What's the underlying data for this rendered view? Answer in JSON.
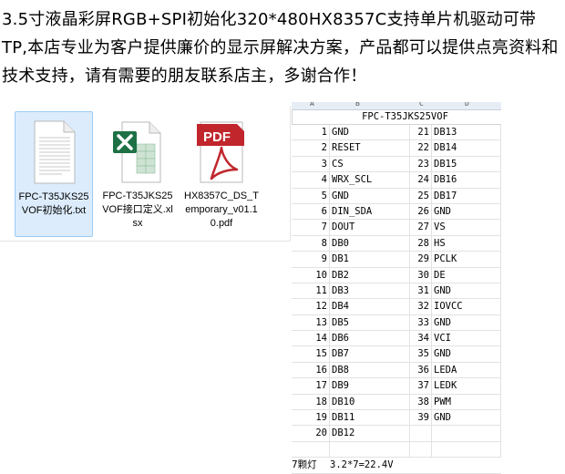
{
  "headline": "3.5寸液晶彩屏RGB+SPI初始化320*480HX8357C支持单片机驱动可带TP,本店专业为客户提供廉价的显示屏解决方案，产品都可以提供点亮资料和技术支持，请有需要的朋友联系店主，多谢合作！",
  "files": [
    {
      "label": "FPC-T35JKS25VOF初始化.txt",
      "icon": "text-file-icon",
      "selected": true
    },
    {
      "label": "FPC-T35JKS25VOF接口定义.xlsx",
      "icon": "excel-file-icon",
      "selected": false
    },
    {
      "label": "HX8357C_DS_Temporary_v01.10.pdf",
      "icon": "pdf-file-icon",
      "selected": false
    }
  ],
  "pdf_badge": "PDF",
  "sheet": {
    "col_headers": [
      "A",
      "B",
      "C",
      "D"
    ],
    "title": "FPC-T35JKS25VOF",
    "rows": [
      {
        "n1": "1",
        "s1": "GND",
        "n2": "21",
        "s2": "DB13"
      },
      {
        "n1": "2",
        "s1": "RESET",
        "n2": "22",
        "s2": "DB14"
      },
      {
        "n1": "3",
        "s1": "CS",
        "n2": "23",
        "s2": "DB15"
      },
      {
        "n1": "4",
        "s1": "WRX_SCL",
        "n2": "24",
        "s2": "DB16"
      },
      {
        "n1": "5",
        "s1": "GND",
        "n2": "25",
        "s2": "DB17"
      },
      {
        "n1": "6",
        "s1": "DIN_SDA",
        "n2": "26",
        "s2": "GND"
      },
      {
        "n1": "7",
        "s1": "DOUT",
        "n2": "27",
        "s2": "VS"
      },
      {
        "n1": "8",
        "s1": "DB0",
        "n2": "28",
        "s2": "HS"
      },
      {
        "n1": "9",
        "s1": "DB1",
        "n2": "29",
        "s2": "PCLK"
      },
      {
        "n1": "10",
        "s1": "DB2",
        "n2": "30",
        "s2": "DE"
      },
      {
        "n1": "11",
        "s1": "DB3",
        "n2": "31",
        "s2": "GND"
      },
      {
        "n1": "12",
        "s1": "DB4",
        "n2": "32",
        "s2": "IOVCC"
      },
      {
        "n1": "13",
        "s1": "DB5",
        "n2": "33",
        "s2": "GND"
      },
      {
        "n1": "14",
        "s1": "DB6",
        "n2": "34",
        "s2": "VCI"
      },
      {
        "n1": "15",
        "s1": "DB7",
        "n2": "35",
        "s2": "GND"
      },
      {
        "n1": "16",
        "s1": "DB8",
        "n2": "36",
        "s2": "LEDA"
      },
      {
        "n1": "17",
        "s1": "DB9",
        "n2": "37",
        "s2": "LEDK"
      },
      {
        "n1": "18",
        "s1": "DB10",
        "n2": "38",
        "s2": "PWM"
      },
      {
        "n1": "19",
        "s1": "DB11",
        "n2": "39",
        "s2": "GND"
      },
      {
        "n1": "20",
        "s1": "DB12",
        "n2": "",
        "s2": ""
      }
    ],
    "note_label": "7颗灯",
    "note_value": "3.2*7=22.4V"
  },
  "colors": {
    "selection_bg": "#dcecfc",
    "selection_border": "#9ccbf3",
    "excel_green": "#1e7145",
    "pdf_red": "#c0262c"
  }
}
